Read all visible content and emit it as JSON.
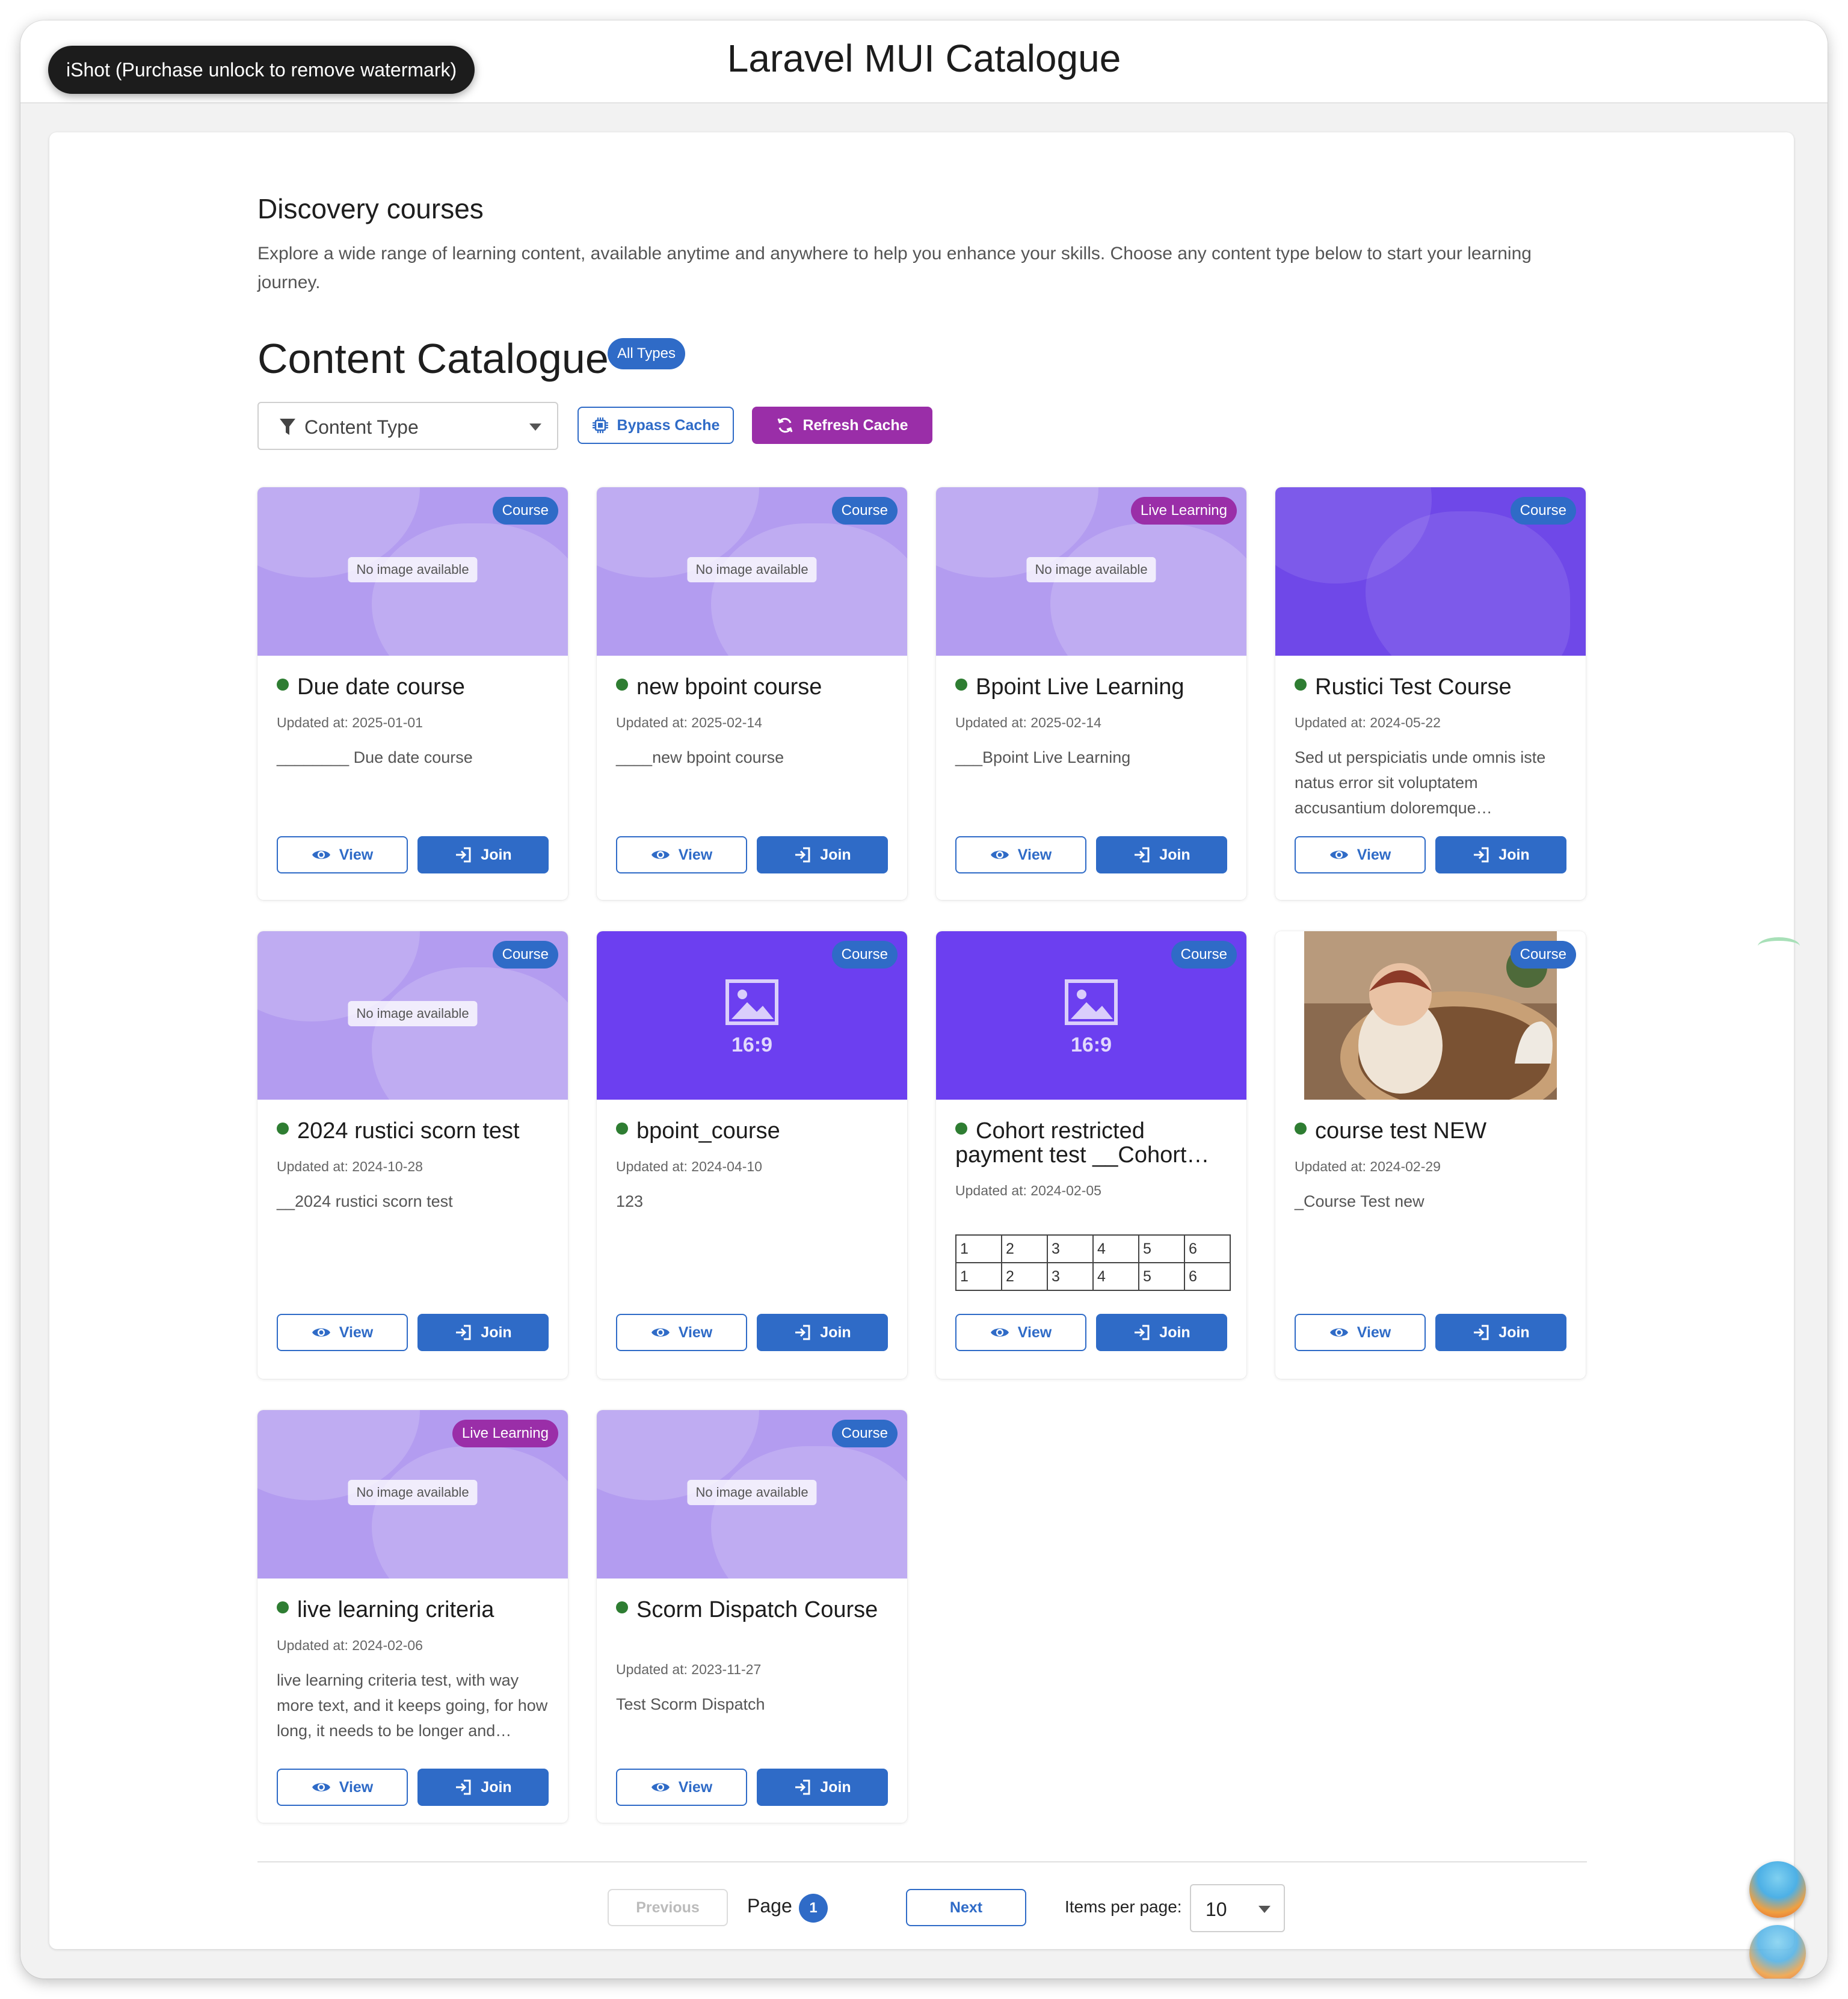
{
  "app_title": "Laravel MUI Catalogue",
  "watermark": "iShot (Purchase unlock to remove watermark)",
  "discovery": {
    "title": "Discovery courses",
    "description": "Explore a wide range of learning content, available anytime and anywhere to help you enhance your skills. Choose any content type below to start your learning journey."
  },
  "catalogue": {
    "title": "Content Catalogue",
    "type_chip": "All Types",
    "filter_label": "Content Type",
    "bypass_label": "Bypass Cache",
    "refresh_label": "Refresh Cache"
  },
  "cards": [
    {
      "title": "Due date course",
      "type": "Course",
      "updated": "Updated at: 2025-01-01",
      "description": "________ Due date course",
      "media_label": "No image available"
    },
    {
      "title": "new bpoint course",
      "type": "Course",
      "updated": "Updated at: 2025-02-14",
      "description": "____new bpoint course",
      "media_label": "No image available"
    },
    {
      "title": "Bpoint Live Learning",
      "type": "Live Learning",
      "updated": "Updated at: 2025-02-14",
      "description": "___Bpoint Live Learning",
      "media_label": "No image available"
    },
    {
      "title": "Rustici Test Course",
      "type": "Course",
      "updated": "Updated at: 2024-05-22",
      "description": "Sed ut perspiciatis unde omnis iste natus error sit voluptatem accusantium doloremque…"
    },
    {
      "title": "2024 rustici scorn test",
      "type": "Course",
      "updated": "Updated at: 2024-10-28",
      "description": "__2024 rustici scorn test",
      "media_label": "No image available"
    },
    {
      "title": "bpoint_course",
      "type": "Course",
      "updated": "Updated at: 2024-04-10",
      "description": "123",
      "media_label": "16:9"
    },
    {
      "title": "Cohort restricted payment test __Cohort…",
      "type": "Course",
      "updated": "Updated at: 2024-02-05",
      "media_label": "16:9",
      "table_rows": [
        [
          "1",
          "2",
          "3",
          "4",
          "5",
          "6"
        ],
        [
          "1",
          "2",
          "3",
          "4",
          "5",
          "6"
        ]
      ]
    },
    {
      "title": "course test NEW",
      "type": "Course",
      "updated": "Updated at: 2024-02-29",
      "description": "_Course Test new"
    },
    {
      "title": "live learning criteria",
      "type": "Live Learning",
      "updated": "Updated at: 2024-02-06",
      "description": "live learning criteria test, with way more text, and it keeps going, for how long, it needs to be longer and…",
      "media_label": "No image available"
    },
    {
      "title": "Scorm Dispatch Course",
      "type": "Course",
      "updated": "Updated at: 2023-11-27",
      "description": "Test Scorm Dispatch",
      "media_label": "No image available"
    }
  ],
  "card_actions": {
    "view_label": "View",
    "join_label": "Join"
  },
  "pagination": {
    "previous_label": "Previous",
    "page_label": "Page",
    "current_page": "1",
    "next_label": "Next",
    "items_per_page_label": "Items per page:",
    "items_per_page": "10"
  },
  "icons": {
    "filter": "funnel-icon",
    "bypass": "chip-icon",
    "refresh": "refresh-icon",
    "view": "eye-icon",
    "join": "login-arrow-icon",
    "media": "image-icon"
  },
  "colors": {
    "primary": "#2f6bc7",
    "secondary": "#9a2ea8",
    "status_dot": "#2e7d32",
    "media_soft": "#b39cf0",
    "media_deep": "#6f48e8"
  }
}
